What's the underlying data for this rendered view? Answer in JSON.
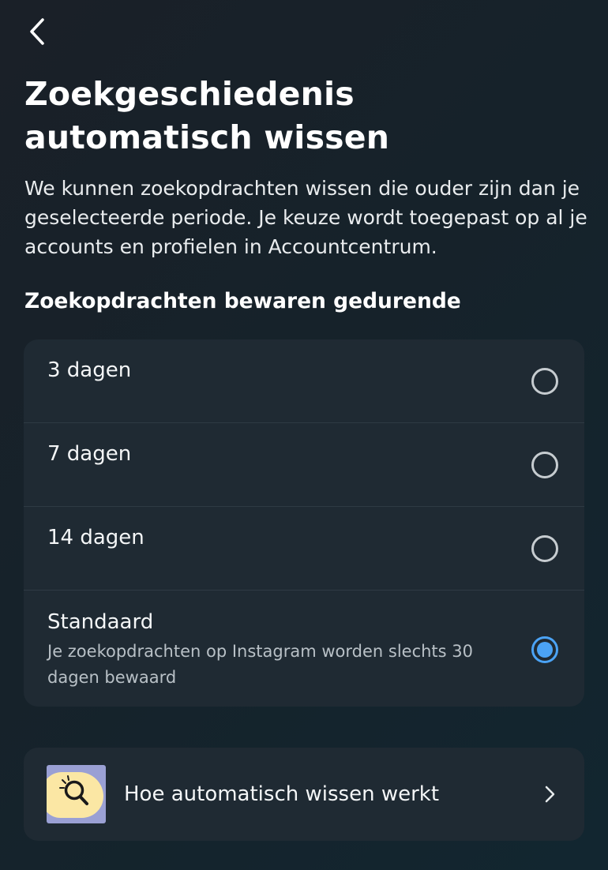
{
  "header": {
    "back_icon": "chevron-left-icon",
    "title": "Zoekgeschiedenis automatisch wissen",
    "description": "We kunnen zoekopdrachten wissen die ouder zijn dan je geselecteerde periode. Je keuze wordt toegepast op al je accounts en profielen in Accountcentrum."
  },
  "retention": {
    "heading": "Zoekopdrachten bewaren gedurende",
    "selected_index": 3,
    "options": [
      {
        "label": "3 dagen",
        "subtitle": "",
        "selected": false
      },
      {
        "label": "7 dagen",
        "subtitle": "",
        "selected": false
      },
      {
        "label": "14 dagen",
        "subtitle": "",
        "selected": false
      },
      {
        "label": "Standaard",
        "subtitle": "Je zoekopdrachten op Instagram worden slechts 30 dagen bewaard",
        "selected": true
      }
    ]
  },
  "info": {
    "label": "Hoe automatisch wissen werkt",
    "thumbnail_icon": "magnifier-icon",
    "chevron_icon": "chevron-right-icon"
  },
  "colors": {
    "background": "#16222a",
    "card": "#1f2a33",
    "accent": "#4ba3f5",
    "text": "#f4f6f7",
    "secondary_text": "#b8c0c6"
  }
}
